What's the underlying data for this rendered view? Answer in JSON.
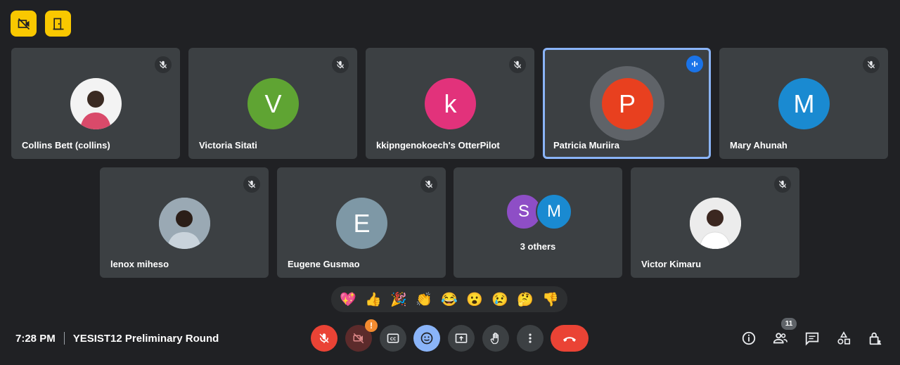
{
  "top_buttons": [
    {
      "icon": "camera-off-icon"
    },
    {
      "icon": "door-exit-icon"
    }
  ],
  "participants": [
    {
      "name": "Collins Bett (collins)",
      "avatar_type": "photo",
      "muted": true
    },
    {
      "name": "Victoria Sitati",
      "initial": "V",
      "color": "#5fa433",
      "muted": true
    },
    {
      "name": "kkipngenokoech's OtterPilot",
      "initial": "k",
      "color": "#e2327b",
      "muted": true
    },
    {
      "name": "Patricia Muriira",
      "initial": "P",
      "color": "#e8401f",
      "speaking": true
    },
    {
      "name": "Mary Ahunah",
      "initial": "M",
      "color": "#1a8ad1",
      "muted": true
    },
    {
      "name": "lenox miheso",
      "avatar_type": "photo",
      "muted": true
    },
    {
      "name": "Eugene Gusmao",
      "initial": "E",
      "color": "#7e98a6",
      "muted": true
    },
    {
      "name": "Victor Kimaru",
      "avatar_type": "photo",
      "muted": true
    }
  ],
  "others_tile": {
    "label": "3 others",
    "initials": [
      {
        "initial": "S",
        "color": "#8e4ec6"
      },
      {
        "initial": "M",
        "color": "#1a8ad1"
      }
    ]
  },
  "reactions": [
    "💖",
    "👍",
    "🎉",
    "👏",
    "😂",
    "😮",
    "😢",
    "🤔",
    "👎"
  ],
  "meeting": {
    "time": "7:28 PM",
    "title": "YESIST12 Preliminary Round"
  },
  "controls": {
    "camera_badge": "!",
    "participant_count": "11"
  }
}
